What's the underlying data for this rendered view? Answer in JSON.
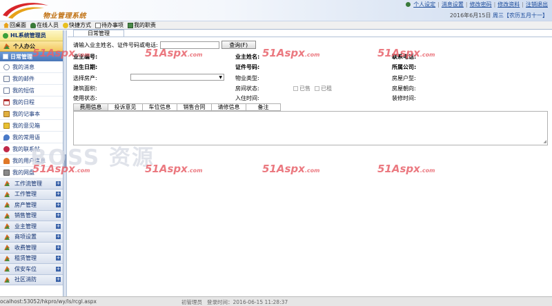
{
  "header": {
    "app_title": "物业管理系统",
    "links": [
      "个人设定",
      "消息设置",
      "修改密码",
      "修改资料",
      "注销退出"
    ],
    "date": "2016年6月15日",
    "weekday": "周三【农历五月十一】"
  },
  "toolbar": {
    "items": [
      {
        "label": "回桌面",
        "icon": "home-icon"
      },
      {
        "label": "在线人员",
        "icon": "users-icon"
      },
      {
        "label": "快捷方式",
        "icon": "shortcut-icon"
      },
      {
        "label": "待办事项",
        "icon": "todo-icon"
      },
      {
        "label": "我的职责",
        "icon": "duty-icon"
      }
    ]
  },
  "sidebar": {
    "admin": "HL系统管理员",
    "personal": "个人办公",
    "daily": "日常管理",
    "items": [
      {
        "label": "我的消息",
        "icon": "message-icon"
      },
      {
        "label": "我的邮件",
        "icon": "mail-icon"
      },
      {
        "label": "我的短信",
        "icon": "sms-icon"
      },
      {
        "label": "我的日程",
        "icon": "calendar-icon"
      },
      {
        "label": "我的记事本",
        "icon": "notebook-icon"
      },
      {
        "label": "我的意见箱",
        "icon": "suggestion-icon"
      },
      {
        "label": "我的常用语",
        "icon": "phrase-icon"
      },
      {
        "label": "我的联系帖",
        "icon": "contact-icon"
      },
      {
        "label": "我的用户信息",
        "icon": "userinfo-icon"
      },
      {
        "label": "我的网盘",
        "icon": "disk-icon"
      }
    ],
    "groups": [
      "工作流管理",
      "工作管理",
      "房产管理",
      "销售管理",
      "业主管理",
      "商项设置",
      "收费管理",
      "租赁管理",
      "保安车位",
      "社区消防"
    ]
  },
  "main": {
    "tab": "日常管理",
    "search_label": "请输入业主姓名、证件号码或电话:",
    "search_value": "",
    "search_button": "查询(F)",
    "fields": {
      "owner_no": "业主编号:",
      "owner_name": "业主姓名:",
      "phone": "联系电话:",
      "birth": "出生日期:",
      "id_no": "证件号码:",
      "company": "所属公司:",
      "select_room": "选择房产:",
      "select_value": "",
      "prop_type": "物业类型:",
      "house_type": "房屋户型:",
      "area": "建筑面积:",
      "room_status": "房间状态:",
      "sold": "已售",
      "rented": "已租",
      "orientation": "房屋朝向:",
      "use_status": "使用状态:",
      "checkin": "入住时间:",
      "decoration": "装修时间:"
    },
    "detail_tabs": [
      "费用信息",
      "投诉意见",
      "车位信息",
      "销售合同",
      "请修信息",
      "备注"
    ]
  },
  "watermark": {
    "brand": "51Aspx",
    "suffix": ".com",
    "boss": "BOSS 资源"
  },
  "status": {
    "url": "ocalhost:53052/hkpro/wy/ls/rcgl.aspx",
    "user": "初管理员",
    "login": "登录时间：2016-06-15 11:28:37"
  }
}
